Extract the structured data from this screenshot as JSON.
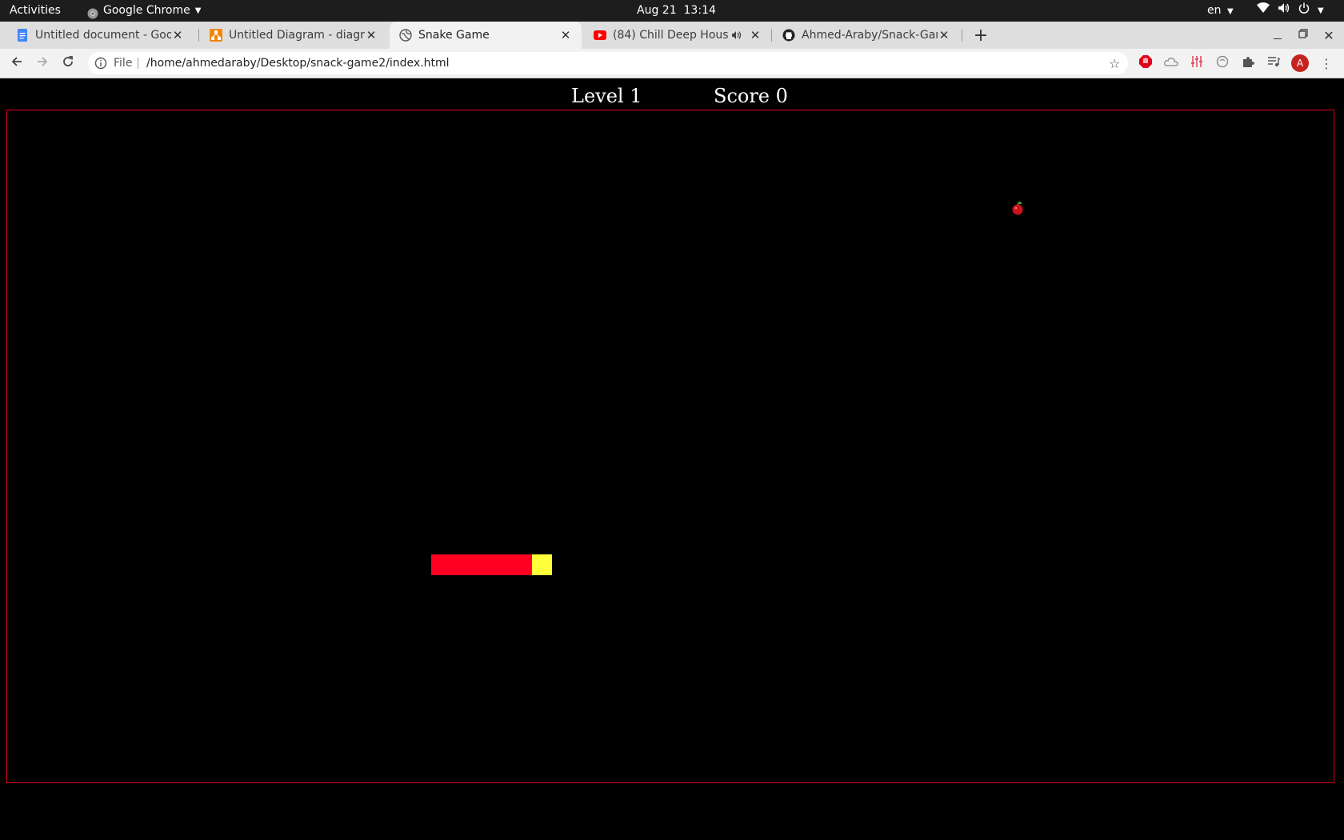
{
  "system_bar": {
    "activities": "Activities",
    "app_name": "Google Chrome",
    "date": "Aug 21",
    "time": "13:14",
    "language": "en"
  },
  "tabs": [
    {
      "title": "Untitled document - Goog",
      "icon": "google-docs-icon",
      "active": false
    },
    {
      "title": "Untitled Diagram - diagra",
      "icon": "diagrams-net-icon",
      "active": false
    },
    {
      "title": "Snake Game",
      "icon": "globe-icon",
      "active": true
    },
    {
      "title": "(84) Chill Deep House",
      "icon": "youtube-icon",
      "active": false
    },
    {
      "title": "Ahmed-Araby/Snack-Gam",
      "icon": "github-icon",
      "active": false
    }
  ],
  "new_tab_label": "+",
  "address_bar": {
    "scheme_label": "File",
    "url": "/home/ahmedaraby/Desktop/snack-game2/index.html"
  },
  "profile_initial": "A",
  "game": {
    "level_label": "Level 1",
    "score_label": "Score 0",
    "colors": {
      "border": "#e0001b",
      "snake_body": "#ff0022",
      "snake_head": "#ffff3a",
      "background": "#000000"
    },
    "apple_icon": "apple-icon"
  }
}
